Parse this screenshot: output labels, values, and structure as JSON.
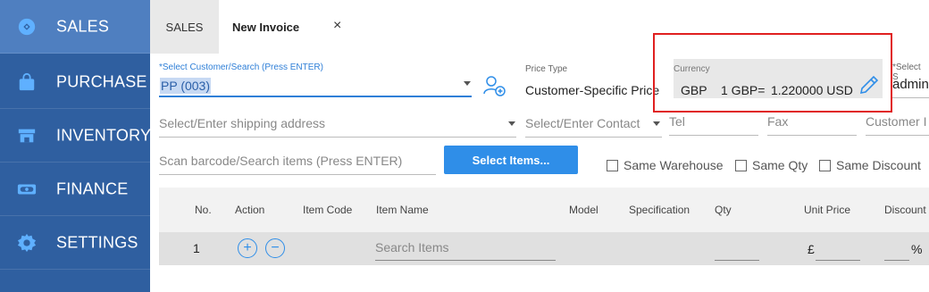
{
  "sidebar": {
    "items": [
      {
        "label": "SALES",
        "icon": "tag-icon"
      },
      {
        "label": "PURCHASE",
        "icon": "shopping-bag-icon"
      },
      {
        "label": "INVENTORY",
        "icon": "store-icon"
      },
      {
        "label": "FINANCE",
        "icon": "money-icon"
      },
      {
        "label": "SETTINGS",
        "icon": "gear-icon"
      }
    ],
    "active": "SALES",
    "colors": {
      "bg": "#2f5fa0",
      "active_bg": "#4f7fc0"
    }
  },
  "tabs": {
    "sales": "SALES",
    "new_invoice": "New Invoice",
    "close": "×"
  },
  "form": {
    "customer_label": "*Select Customer/Search (Press ENTER)",
    "customer_value": "PP (003)",
    "price_type_label": "Price Type",
    "price_type_value": "Customer-Specific Price",
    "currency_label": "Currency",
    "currency_code": "GBP",
    "currency_rate": "1 GBP=",
    "currency_value": "1.220000 USD",
    "salesperson_label": "*Select S",
    "salesperson_value": "admin",
    "shipping_placeholder": "Select/Enter shipping address",
    "contact_placeholder": "Select/Enter Contact",
    "tel_placeholder": "Tel",
    "fax_placeholder": "Fax",
    "customer_ref_placeholder": "Customer I",
    "barcode_placeholder": "Scan barcode/Search items (Press ENTER)",
    "select_items_button": "Select Items...",
    "same_warehouse": "Same Warehouse",
    "same_qty": "Same Qty",
    "same_discount": "Same Discount"
  },
  "table": {
    "headers": [
      "No.",
      "Action",
      "Item Code",
      "Item Name",
      "Model",
      "Specification",
      "Qty",
      "Unit Price",
      "Discount"
    ],
    "rows": [
      {
        "no": "1",
        "item_placeholder": "Search Items",
        "currency_symbol": "£",
        "percent": "%"
      }
    ]
  },
  "accent_color": "#2f8ee8",
  "highlight_color": "#e02020"
}
